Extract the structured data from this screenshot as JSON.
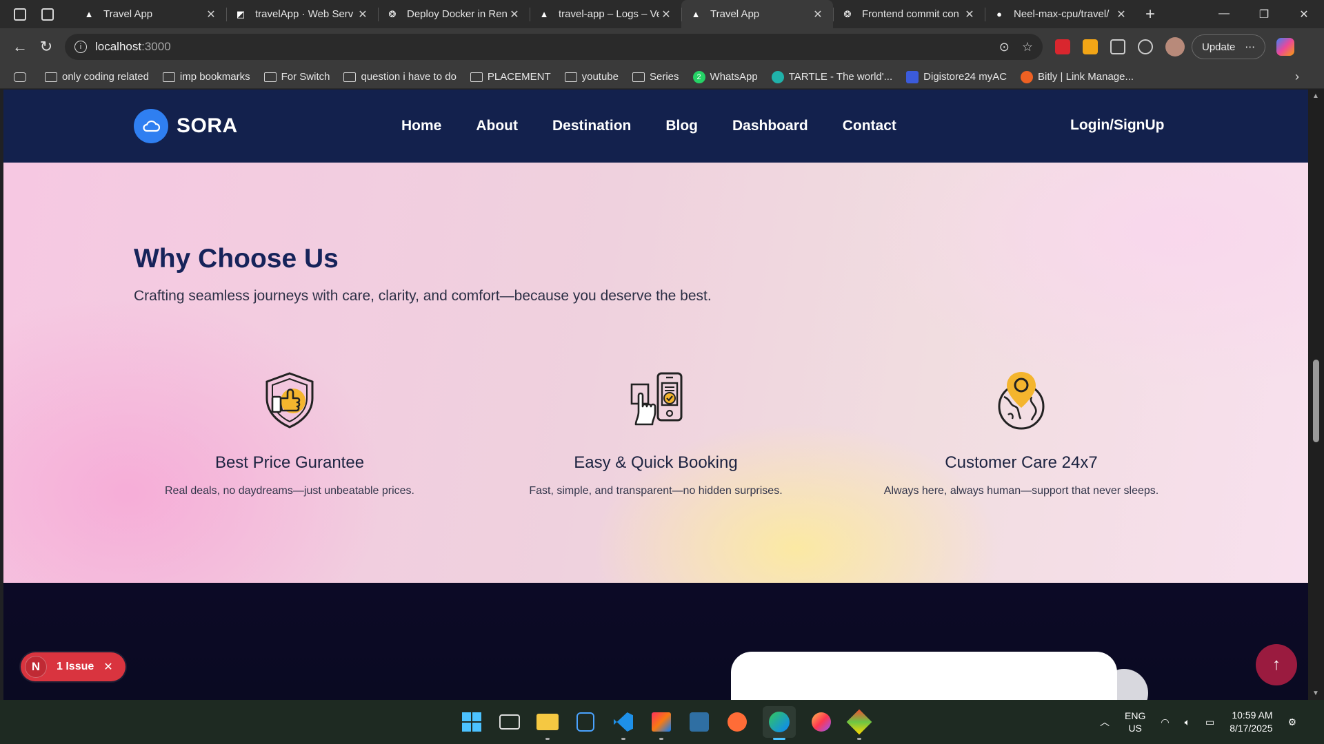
{
  "browser": {
    "tabs": [
      {
        "title": "Travel App",
        "favicon": "vercel-icon",
        "active": false
      },
      {
        "title": "travelApp · Web Serv",
        "favicon": "render-icon",
        "active": false
      },
      {
        "title": "Deploy Docker in Ren",
        "favicon": "chatgpt-icon",
        "active": false
      },
      {
        "title": "travel-app – Logs – Ve",
        "favicon": "vercel-icon",
        "active": false
      },
      {
        "title": "Travel App",
        "favicon": "vercel-icon",
        "active": true
      },
      {
        "title": "Frontend commit con",
        "favicon": "chatgpt-icon",
        "active": false
      },
      {
        "title": "Neel-max-cpu/travel/",
        "favicon": "github-icon",
        "active": false
      }
    ],
    "url_host": "localhost",
    "url_port": ":3000",
    "update_label": "Update",
    "bookmarks": [
      {
        "label": "only coding  related",
        "type": "folder"
      },
      {
        "label": "imp bookmarks",
        "type": "folder"
      },
      {
        "label": "For Switch",
        "type": "folder"
      },
      {
        "label": "question i have to do",
        "type": "folder"
      },
      {
        "label": "PLACEMENT",
        "type": "folder"
      },
      {
        "label": "youtube",
        "type": "folder"
      },
      {
        "label": "Series",
        "type": "folder"
      },
      {
        "label": "WhatsApp",
        "type": "site",
        "color": "#25d366",
        "badge": "2"
      },
      {
        "label": "TARTLE - The world'...",
        "type": "site",
        "color": "#20b2aa"
      },
      {
        "label": "Digistore24 myAC",
        "type": "site",
        "color": "#3b5bdb"
      },
      {
        "label": "Bitly | Link Manage...",
        "type": "site",
        "color": "#ee6123"
      }
    ]
  },
  "site": {
    "logo_text": "SORA",
    "nav": [
      "Home",
      "About",
      "Destination",
      "Blog",
      "Dashboard",
      "Contact"
    ],
    "login_label": "Login/SignUp",
    "why": {
      "title": "Why Choose Us",
      "subtitle": "Crafting seamless journeys with care, clarity, and comfort—because you deserve the best.",
      "features": [
        {
          "icon": "shield-thumbs-up-icon",
          "title": "Best Price Gurantee",
          "desc": "Real deals, no daydreams—just unbeatable prices."
        },
        {
          "icon": "phone-booking-icon",
          "title": "Easy & Quick Booking",
          "desc": "Fast, simple, and transparent—no hidden surprises."
        },
        {
          "icon": "globe-pin-icon",
          "title": "Customer Care 24x7",
          "desc": "Always here, always human—support that never sleeps."
        }
      ]
    },
    "issue_badge": {
      "letter": "N",
      "label": "1 Issue"
    },
    "colors": {
      "header": "#13214d",
      "accent": "#f4b52e",
      "logo_badge": "#2f7ff1",
      "to_top": "#9a1b3f"
    }
  },
  "taskbar": {
    "language": "ENG",
    "region": "US",
    "time": "10:59 AM",
    "date": "8/17/2025"
  }
}
